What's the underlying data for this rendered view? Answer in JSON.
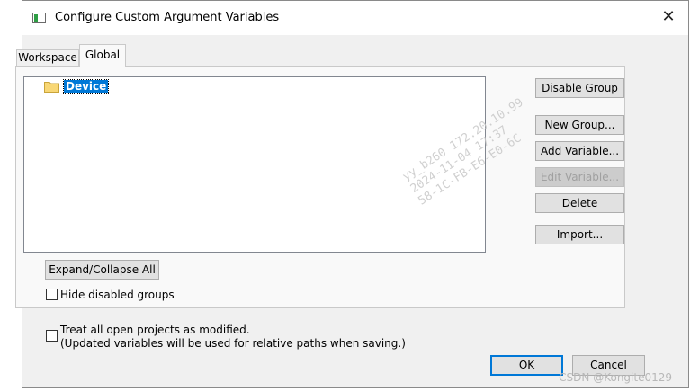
{
  "window": {
    "title": "Configure Custom Argument Variables",
    "close_glyph": "✕"
  },
  "tabs": [
    {
      "label": "Workspace",
      "active": false
    },
    {
      "label": "Global",
      "active": true
    }
  ],
  "tree": {
    "items": [
      {
        "label": "Device",
        "icon": "folder-icon",
        "selected": true,
        "icon_color": "#f8d775"
      }
    ]
  },
  "buttons": {
    "disable_group": "Disable Group",
    "new_group": "New Group...",
    "add_variable": "Add Variable...",
    "edit_variable": "Edit Variable...",
    "delete": "Delete",
    "import": "Import...",
    "expand_collapse": "Expand/Collapse All",
    "ok": "OK",
    "cancel": "Cancel"
  },
  "checkboxes": {
    "hide_disabled": {
      "label": "Hide disabled groups",
      "checked": false
    },
    "treat_modified": {
      "line1": "Treat all open projects as modified.",
      "line2": "(Updated variables will be used for relative paths when saving.)",
      "checked": false
    }
  },
  "watermark": {
    "line1": "yy_b260   172.20.10.99",
    "line2": "2024-11-04  17:37",
    "line3": "58-1C-FB-E6-E0-6C"
  },
  "credit": "CSDN @Kongite0129",
  "colors": {
    "selection": "#0078d7",
    "default_button_border": "#0078d7",
    "folder": "#f8d775"
  }
}
